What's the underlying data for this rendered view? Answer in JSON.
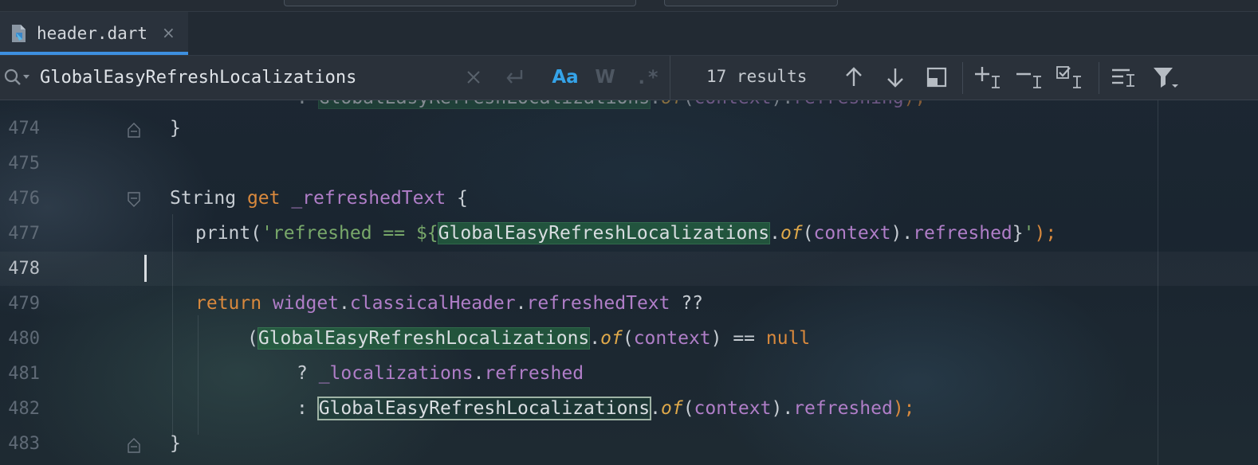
{
  "tab": {
    "file_name": "header.dart",
    "close_glyph": "×"
  },
  "search": {
    "query": "GlobalEasyRefreshLocalizations",
    "match_case_label": "Aa",
    "words_label": "W",
    "regex_label": ".*",
    "results_text": "17 results",
    "icons": [
      "search-icon",
      "clear-icon",
      "new-line-icon",
      "match-case-icon",
      "words-icon",
      "regex-icon",
      "previous-occurrence-icon",
      "next-occurrence-icon",
      "open-in-window-icon",
      "add-selection-icon",
      "remove-selection-icon",
      "select-all-occurrences-icon",
      "filter-options-icon",
      "filter-icon"
    ]
  },
  "colors": {
    "accent": "#3d8fe0",
    "keyword": "#d9893d",
    "function": "#e0a94a",
    "property": "#b07ec8",
    "string": "#78a86a",
    "match_highlight": "#287846"
  },
  "editor": {
    "current_line": "478",
    "lines": [
      {
        "num": "474",
        "t": {
          "a": "}"
        }
      },
      {
        "num": "475",
        "t": {}
      },
      {
        "num": "476",
        "t": {
          "a": "String ",
          "b": "get ",
          "c": "_refreshedText",
          "d": " {"
        }
      },
      {
        "num": "477",
        "t": {
          "a": "print(",
          "b": "'refreshed == ${",
          "c": "GlobalEasyRefreshLocalizations",
          "d": ".",
          "e": "of",
          "f": "(",
          "g": "context",
          "h": ").",
          "i": "refreshed",
          "j": "}",
          "k": "'",
          "l": ");"
        }
      },
      {
        "num": "478",
        "t": {}
      },
      {
        "num": "479",
        "t": {
          "a": "return ",
          "b": "widget",
          "c": ".",
          "d": "classicalHeader",
          "e": ".",
          "f": "refreshedText",
          "g": " ??"
        }
      },
      {
        "num": "480",
        "t": {
          "a": "(",
          "b": "GlobalEasyRefreshLocalizations",
          "c": ".",
          "d": "of",
          "e": "(",
          "f": "context",
          "g": ") == ",
          "h": "null"
        }
      },
      {
        "num": "481",
        "t": {
          "a": "? ",
          "b": "_localizations",
          "c": ".",
          "d": "refreshed"
        }
      },
      {
        "num": "482",
        "t": {
          "a": ": ",
          "b": "GlobalEasyRefreshLocalizations",
          "c": ".",
          "d": "of",
          "e": "(",
          "f": "context",
          "g": ").",
          "h": "refreshed",
          "i": ");"
        }
      },
      {
        "num": "483",
        "t": {
          "a": "}"
        }
      }
    ]
  }
}
